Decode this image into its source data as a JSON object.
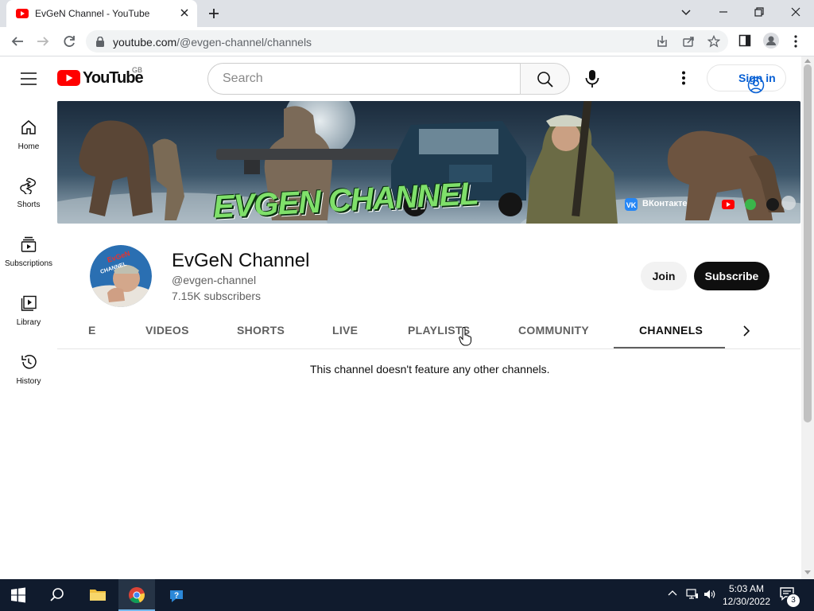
{
  "browser": {
    "tab_title": "EvGeN Channel - YouTube",
    "url_host": "youtube.com",
    "url_path": "/@evgen-channel/channels"
  },
  "masthead": {
    "logo_text": "YouTube",
    "country_code": "GB",
    "search_placeholder": "Search",
    "signin_label": "Sign in"
  },
  "guide": {
    "items": [
      {
        "label": "Home",
        "icon": "home-icon"
      },
      {
        "label": "Shorts",
        "icon": "shorts-icon"
      },
      {
        "label": "Subscriptions",
        "icon": "subscriptions-icon"
      },
      {
        "label": "Library",
        "icon": "library-icon"
      },
      {
        "label": "History",
        "icon": "history-icon"
      }
    ]
  },
  "banner": {
    "title_art": "EVGEN CHANNEL",
    "social_text": "ВКонтакте"
  },
  "channel": {
    "name": "EvGeN Channel",
    "handle": "@evgen-channel",
    "subscribers": "7.15K subscribers",
    "join_label": "Join",
    "subscribe_label": "Subscribe",
    "avatar_text": "EvGeN CHANNEL"
  },
  "tabs": {
    "items": [
      "E",
      "VIDEOS",
      "SHORTS",
      "LIVE",
      "PLAYLISTS",
      "COMMUNITY",
      "CHANNELS"
    ],
    "active": "CHANNELS"
  },
  "content": {
    "empty_message": "This channel doesn't feature any other channels."
  },
  "taskbar": {
    "time": "5:03 AM",
    "date": "12/30/2022",
    "notification_count": "3"
  },
  "colors": {
    "youtube_red": "#ff0000",
    "link_blue": "#065fd4",
    "taskbar_bg": "#101b2d"
  }
}
